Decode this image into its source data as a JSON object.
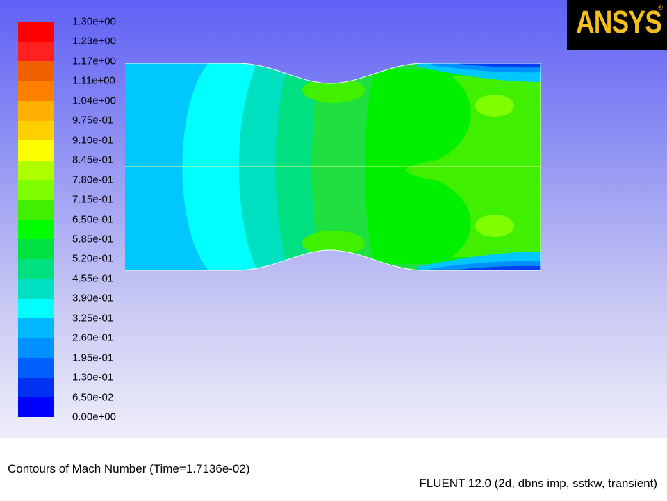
{
  "colorbar": {
    "colors": [
      "#0000ff",
      "#0030f0",
      "#0060ff",
      "#0090ff",
      "#00b8ff",
      "#00ffff",
      "#00e0c0",
      "#00e080",
      "#00e040",
      "#00ff00",
      "#40f000",
      "#80ff00",
      "#b0ff00",
      "#ffff00",
      "#ffd000",
      "#ffb000",
      "#ff8000",
      "#f06000",
      "#ff2020",
      "#ff0000"
    ],
    "labels": [
      "1.30e+00",
      "1.23e+00",
      "1.17e+00",
      "1.11e+00",
      "1.04e+00",
      "9.75e-01",
      "9.10e-01",
      "8.45e-01",
      "7.80e-01",
      "7.15e-01",
      "6.50e-01",
      "5.85e-01",
      "5.20e-01",
      "4.55e-01",
      "3.90e-01",
      "3.25e-01",
      "2.60e-01",
      "1.95e-01",
      "1.30e-01",
      "6.50e-02",
      "0.00e+00"
    ]
  },
  "logo": {
    "text": "ANSYS",
    "mark": "®"
  },
  "footer": {
    "title": "Contours of Mach Number  (Time=1.7136e-02)",
    "solver": "FLUENT 12.0 (2d, dbns imp, sstkw, transient)"
  }
}
